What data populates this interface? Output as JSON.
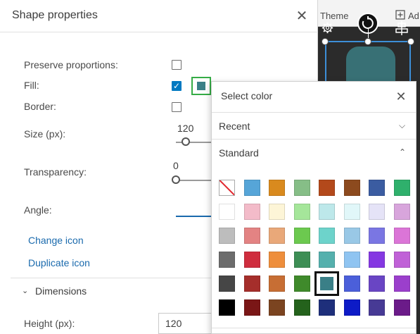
{
  "canvas": {
    "theme_label": "Theme",
    "add_label": "Ad"
  },
  "panel": {
    "title": "Shape properties",
    "close_icon": "close-icon",
    "preserve_proportions_label": "Preserve proportions:",
    "preserve_proportions_checked": false,
    "fill_label": "Fill:",
    "fill_checked": true,
    "fill_color": "#3a7f87",
    "border_label": "Border:",
    "border_checked": false,
    "size_label": "Size (px):",
    "size_value": "120",
    "transparency_label": "Transparency:",
    "transparency_value": "0",
    "angle_label": "Angle:",
    "change_icon_link": "Change icon",
    "duplicate_icon_link": "Duplicate icon",
    "dimensions_label": "Dimensions",
    "height_label": "Height (px):",
    "height_value": "120"
  },
  "color_picker": {
    "title": "Select color",
    "recent_label": "Recent",
    "standard_label": "Standard",
    "selected_color": "#3a7f87",
    "standard_colors": [
      [
        "none",
        "#56a5d8",
        "#d98a1e",
        "#86be87",
        "#b3491b",
        "#8c4a1e",
        "#3b5ca1",
        "#2fb06c"
      ],
      [
        "#ffffff",
        "#f3bbc9",
        "#fdf5d7",
        "#a5e69a",
        "#bde8ea",
        "#e1f7f9",
        "#e5e3f7",
        "#d8a5dc"
      ],
      [
        "#bdbdbd",
        "#e38383",
        "#e9a879",
        "#6cc94f",
        "#6dd3cb",
        "#99c8e6",
        "#7a76e3",
        "#db75d7"
      ],
      [
        "#6c6c6c",
        "#cf2d3e",
        "#ee8e3c",
        "#3d8e55",
        "#55b0ad",
        "#8fc4f1",
        "#8538e2",
        "#c061d7"
      ],
      [
        "#464646",
        "#a52e2b",
        "#c76e34",
        "#3f8a2b",
        "#3a7f87",
        "#4b5fda",
        "#6945c4",
        "#9b3fcc"
      ],
      [
        "#000000",
        "#7a1616",
        "#7b4420",
        "#24621c",
        "#1e2f7b",
        "#0d1bc7",
        "#473a95",
        "#6b1b89"
      ]
    ]
  }
}
